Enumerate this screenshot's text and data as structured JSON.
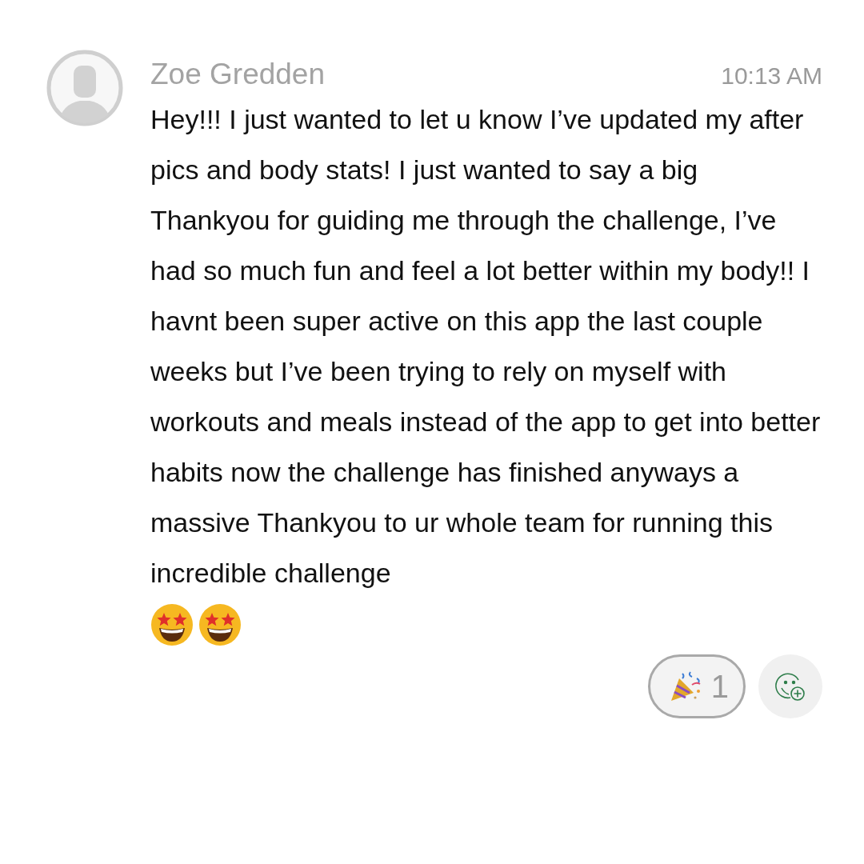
{
  "message": {
    "author": "Zoe Gredden",
    "time": "10:13 AM",
    "text": "Hey!!! I just wanted to let u know I’ve updated my after pics and body stats! I just wanted to say a big Thankyou for guiding me through the challenge, I’ve had so much fun and feel a lot better within my body!! I havnt been super active on this app the last couple weeks but I’ve been trying to rely on myself with workouts and meals instead of the app to get into better habits now the challenge has finished anyways a massive Thankyou to ur whole team for running this incredible challenge",
    "emojis": [
      {
        "kind": "star-struck"
      },
      {
        "kind": "star-struck"
      }
    ]
  },
  "reactions": [
    {
      "kind": "party-popper",
      "count": "1",
      "selected": false
    }
  ]
}
